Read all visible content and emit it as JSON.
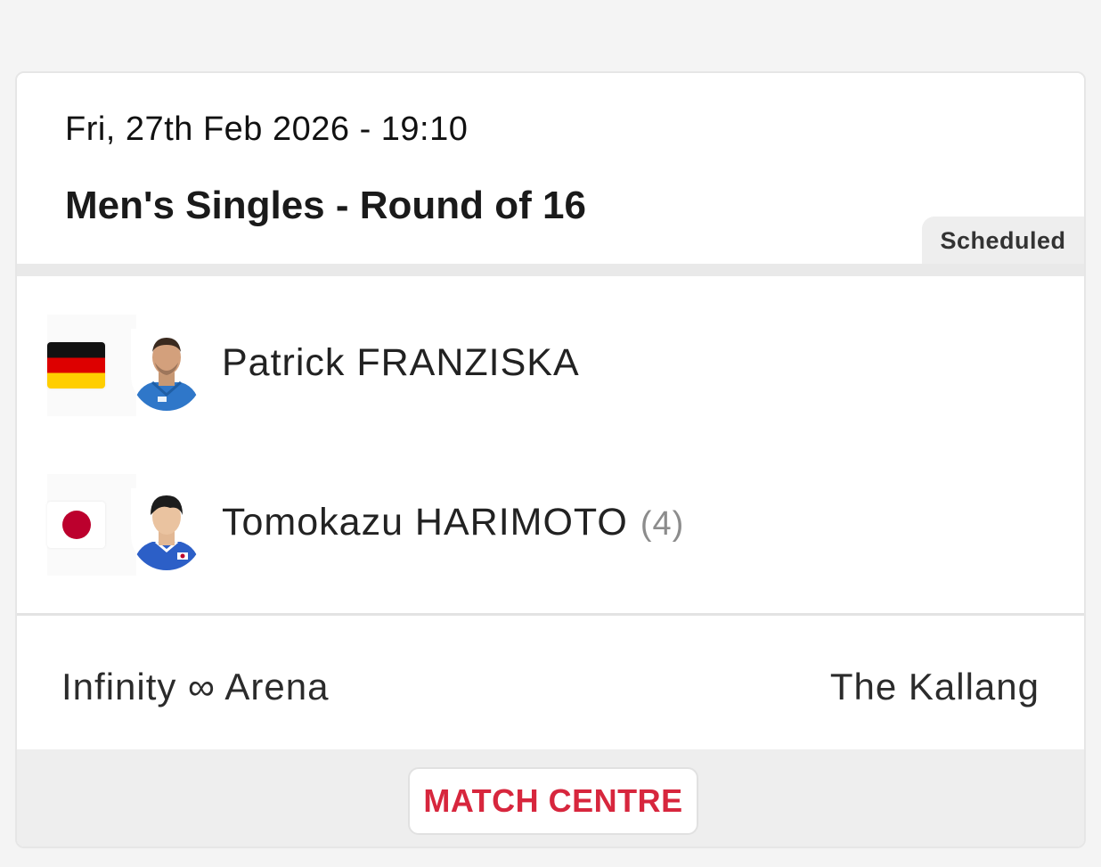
{
  "match": {
    "datetime": "Fri, 27th Feb 2026 - 19:10",
    "event": "Men's Singles - Round of 16",
    "status": "Scheduled"
  },
  "players": [
    {
      "name": "Patrick FRANZISKA",
      "seed": "",
      "flag": "germany-flag-icon",
      "avatar": "player-photo-franziska"
    },
    {
      "name": "Tomokazu HARIMOTO",
      "seed": "(4)",
      "flag": "japan-flag-icon",
      "avatar": "player-photo-harimoto"
    }
  ],
  "venue": {
    "hall": "Infinity ∞ Arena",
    "location": "The Kallang"
  },
  "footer": {
    "match_centre_label": "MATCH CENTRE"
  },
  "colors": {
    "accent_red": "#d7263d",
    "badge_bg": "#eeeeee",
    "footer_bg": "#eeeeee"
  }
}
